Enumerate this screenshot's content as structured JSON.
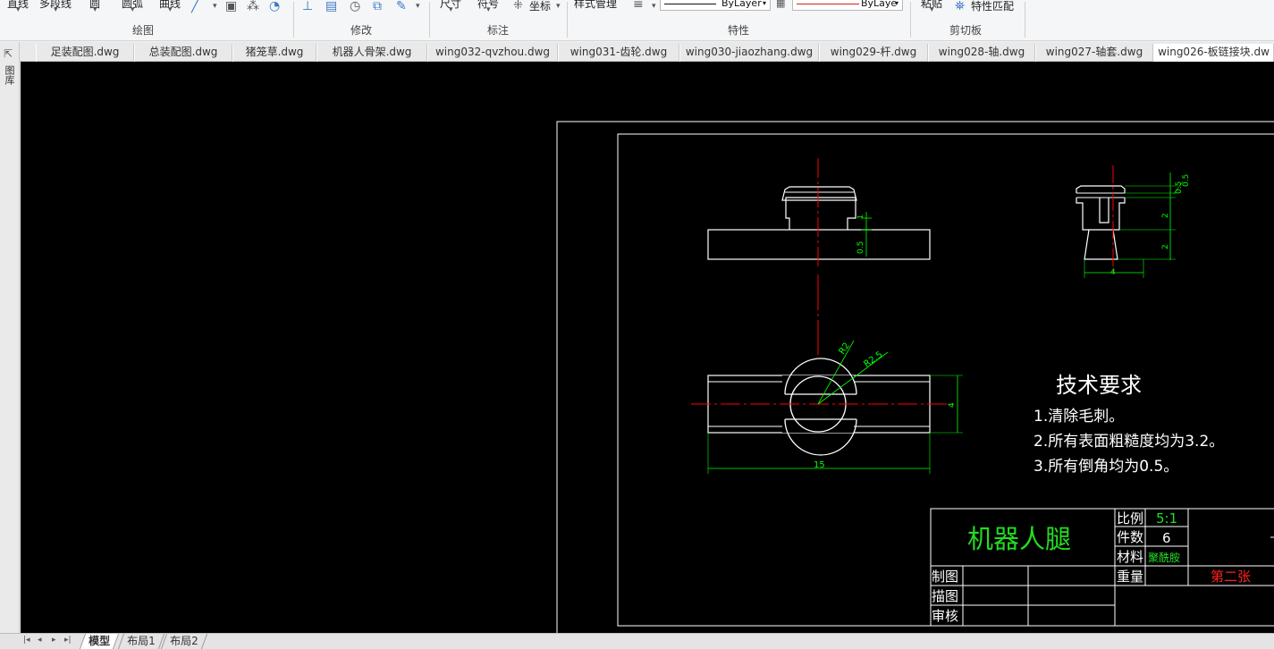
{
  "ribbon": {
    "draw_group": {
      "top_labels": [
        "直线",
        "多段线",
        "圆",
        "圆弧",
        "曲线"
      ],
      "label": "绘图"
    },
    "modify_group": {
      "label": "修改"
    },
    "annotate_group": {
      "top_labels": [
        "尺寸",
        "符号",
        "坐标"
      ],
      "label": "标注"
    },
    "properties_group": {
      "top_labels": [
        "样式管理"
      ],
      "linetype_value": "ByLayer",
      "color_value": "ByLaye",
      "label": "特性"
    },
    "clipboard_group": {
      "top_labels": [
        "粘贴"
      ],
      "match_properties": "特性匹配",
      "label": "剪切板"
    }
  },
  "tabs": [
    "足装配图.dwg",
    "总装配图.dwg",
    "猪笼草.dwg",
    "机器人骨架.dwg",
    "wing032-qvzhou.dwg",
    "wing031-齿轮.dwg",
    "wing030-jiaozhang.dwg",
    "wing029-杆.dwg",
    "wing028-轴.dwg",
    "wing027-轴套.dwg",
    "wing026-板链接块.dw"
  ],
  "left_panel": {
    "label": "图库"
  },
  "drawing": {
    "dimensions": {
      "top_view_small": "1",
      "top_view_height": "0.5",
      "side_view_top": "0.5",
      "side_view_top2": "0.5",
      "side_view_mid": "2",
      "side_view_low": "2",
      "side_view_width": "4",
      "radius_inner": "R2",
      "radius_outer": "R2.5",
      "front_height": "4",
      "front_width": "15"
    },
    "tech_title": "技术要求",
    "tech_items": [
      "1.清除毛刺。",
      "2.所有表面粗糙度均为3.2。",
      "3.所有倒角均为0.5。"
    ],
    "title_block": {
      "part_name": "机器人腿",
      "scale_label": "比例",
      "scale_value": "5:1",
      "qty_label": "件数",
      "qty_value": "6",
      "material_label": "材料",
      "material_value": "聚酰胺",
      "weight_label": "重量",
      "sheet_text": "第二张",
      "drawn_label": "制图",
      "traced_label": "描图",
      "checked_label": "审核"
    }
  },
  "layout_tabs": [
    "模型",
    "布局1",
    "布局2"
  ],
  "colors": {
    "canvas_bg": "#000000",
    "line_white": "#ffffff",
    "center_red": "#ff0000",
    "dim_green": "#00ff00",
    "title_green": "#22dd22"
  }
}
